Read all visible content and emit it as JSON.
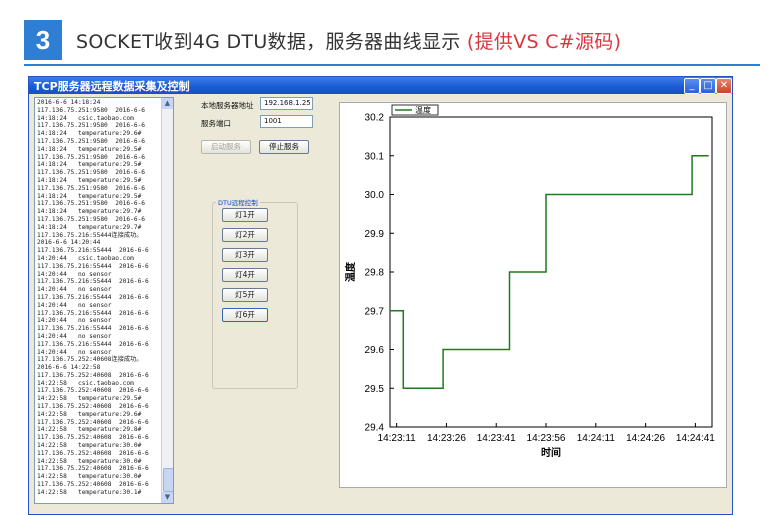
{
  "header": {
    "number": "3",
    "title": "SOCKET收到4G DTU数据，服务器曲线显示",
    "accent": "(提供VS C#源码)"
  },
  "window": {
    "title": "TCP服务器远程数据采集及控制",
    "minimize": "_",
    "maximize": "□",
    "close": "✕"
  },
  "log_lines": [
    "2016-6-6 14:18:24",
    "117.136.75.251:9580  2016-6-6",
    "14:18:24   csic.taobao.com",
    "117.136.75.251:9580  2016-6-6",
    "14:18:24   temperature:29.6#",
    "117.136.75.251:9580  2016-6-6",
    "14:18:24   temperature:29.5#",
    "117.136.75.251:9580  2016-6-6",
    "14:18:24   temperature:29.5#",
    "117.136.75.251:9580  2016-6-6",
    "14:18:24   temperature:29.5#",
    "117.136.75.251:9580  2016-6-6",
    "14:18:24   temperature:29.5#",
    "117.136.75.251:9580  2016-6-6",
    "14:18:24   temperature:29.7#",
    "117.136.75.251:9580  2016-6-6",
    "14:18:24   temperature:29.7#",
    "117.136.75.216:55444连接成功。",
    "2016-6-6 14:20:44",
    "117.136.75.216:55444  2016-6-6",
    "14:20:44   csic.taobao.com",
    "117.136.75.216:55444  2016-6-6",
    "14:20:44   no sensor",
    "117.136.75.216:55444  2016-6-6",
    "14:20:44   no sensor",
    "117.136.75.216:55444  2016-6-6",
    "14:20:44   no sensor",
    "117.136.75.216:55444  2016-6-6",
    "14:20:44   no sensor",
    "117.136.75.216:55444  2016-6-6",
    "14:20:44   no sensor",
    "117.136.75.216:55444  2016-6-6",
    "14:20:44   no sensor",
    "117.136.75.252:40608连接成功。",
    "2016-6-6 14:22:58",
    "117.136.75.252:40608  2016-6-6",
    "14:22:58   csic.taobao.com",
    "117.136.75.252:40608  2016-6-6",
    "14:22:58   temperature:29.5#",
    "117.136.75.252:40608  2016-6-6",
    "14:22:58   temperature:29.6#",
    "117.136.75.252:40608  2016-6-6",
    "14:22:58   temperature:29.8#",
    "117.136.75.252:40608  2016-6-6",
    "14:22:58   temperature:30.0#",
    "117.136.75.252:40608  2016-6-6",
    "14:22:58   temperature:30.0#",
    "117.136.75.252:40608  2016-6-6",
    "14:22:58   temperature:30.0#",
    "117.136.75.252:40608  2016-6-6",
    "14:22:58   temperature:30.1#"
  ],
  "form": {
    "address_label": "本地服务器地址",
    "address_value": "192.168.1.25",
    "port_label": "服务端口",
    "port_value": "1001",
    "start_button": "启动服务",
    "stop_button": "停止服务"
  },
  "dtu": {
    "group_title": "DTU远程控制",
    "buttons": [
      "灯1开",
      "灯2开",
      "灯3开",
      "灯4开",
      "灯5开",
      "灯6开"
    ]
  },
  "chart_data": {
    "type": "line",
    "legend": "温度",
    "legend_position": "top-left",
    "xlabel": "时间",
    "ylabel": "温度",
    "ylim": [
      29.4,
      30.2
    ],
    "yticks": [
      29.4,
      29.5,
      29.6,
      29.7,
      29.8,
      29.9,
      30.0,
      30.1,
      30.2
    ],
    "x_tick_labels": [
      "14:23:11",
      "14:23:26",
      "14:23:41",
      "14:23:56",
      "14:24:11",
      "14:24:26",
      "14:24:41"
    ],
    "x_tick_seconds": [
      0,
      15,
      30,
      45,
      60,
      75,
      90
    ],
    "xlim_seconds": [
      -2,
      95
    ],
    "line_color": "#1f7a1f",
    "series": [
      {
        "name": "温度",
        "x_seconds": [
          -2,
          2,
          2,
          14,
          14,
          23,
          23,
          34,
          34,
          45,
          45,
          60,
          60,
          75,
          75,
          89,
          89,
          94
        ],
        "values": [
          29.7,
          29.7,
          29.5,
          29.5,
          29.6,
          29.6,
          29.6,
          29.6,
          29.8,
          29.8,
          30.0,
          30.0,
          30.0,
          30.0,
          30.0,
          30.0,
          30.1,
          30.1
        ]
      }
    ]
  }
}
